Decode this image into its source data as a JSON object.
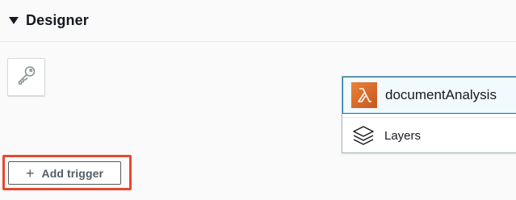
{
  "designer": {
    "title": "Designer",
    "caret_icon": "triangle-down-icon"
  },
  "permissions": {
    "icon": "key-icon"
  },
  "function_node": {
    "name": "documentAnalysis",
    "icon": "lambda-icon",
    "badge_color": "#d86613"
  },
  "layers": {
    "label": "Layers",
    "icon": "layers-icon"
  },
  "trigger": {
    "label": "Add trigger",
    "icon": "plus-icon",
    "highlight_color": "#e8482e"
  }
}
